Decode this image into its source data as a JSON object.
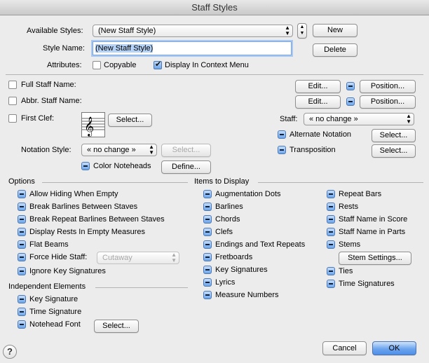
{
  "window": {
    "title": "Staff Styles"
  },
  "top": {
    "available_label": "Available Styles:",
    "available_value": "(New Staff Style)",
    "new_label": "New",
    "style_name_label": "Style Name:",
    "style_name_value": "(New Staff Style)",
    "delete_label": "Delete",
    "attributes_label": "Attributes:",
    "copyable_label": "Copyable",
    "copyable_checked": false,
    "display_label": "Display In Context Menu",
    "display_checked": true
  },
  "staff": {
    "full_label": "Full Staff Name:",
    "abbr_label": "Abbr. Staff Name:",
    "first_clef_label": "First Clef:",
    "edit_label": "Edit...",
    "position_label": "Position...",
    "select_label": "Select...",
    "staff_label": "Staff:",
    "staff_value": "« no change »",
    "alternate_label": "Alternate Notation",
    "transposition_label": "Transposition",
    "notation_label": "Notation Style:",
    "notation_value": "« no change »",
    "color_label": "Color Noteheads",
    "define_label": "Define..."
  },
  "options": {
    "title": "Options",
    "items": [
      "Allow Hiding When Empty",
      "Break Barlines Between Staves",
      "Break Repeat Barlines Between Staves",
      "Display Rests In Empty Measures",
      "Flat Beams",
      "Force Hide Staff:",
      "Ignore Key Signatures"
    ],
    "force_hide_value": "Cutaway"
  },
  "independent": {
    "title": "Independent Elements",
    "items": [
      "Key Signature",
      "Time Signature",
      "Notehead Font"
    ],
    "select_label": "Select..."
  },
  "items_display": {
    "title": "Items to Display",
    "col1": [
      "Augmentation Dots",
      "Barlines",
      "Chords",
      "Clefs",
      "Endings and Text Repeats",
      "Fretboards",
      "Key Signatures",
      "Lyrics",
      "Measure Numbers"
    ],
    "col2": [
      "Repeat Bars",
      "Rests",
      "Staff Name in Score",
      "Staff Name in Parts",
      "Stems"
    ],
    "stem_settings_label": "Stem Settings...",
    "col3": [
      "Ties",
      "Time Signatures"
    ]
  },
  "footer": {
    "help_label": "?",
    "cancel_label": "Cancel",
    "ok_label": "OK"
  },
  "icons": {
    "clef": "treble-clef-icon",
    "help": "help-icon"
  }
}
